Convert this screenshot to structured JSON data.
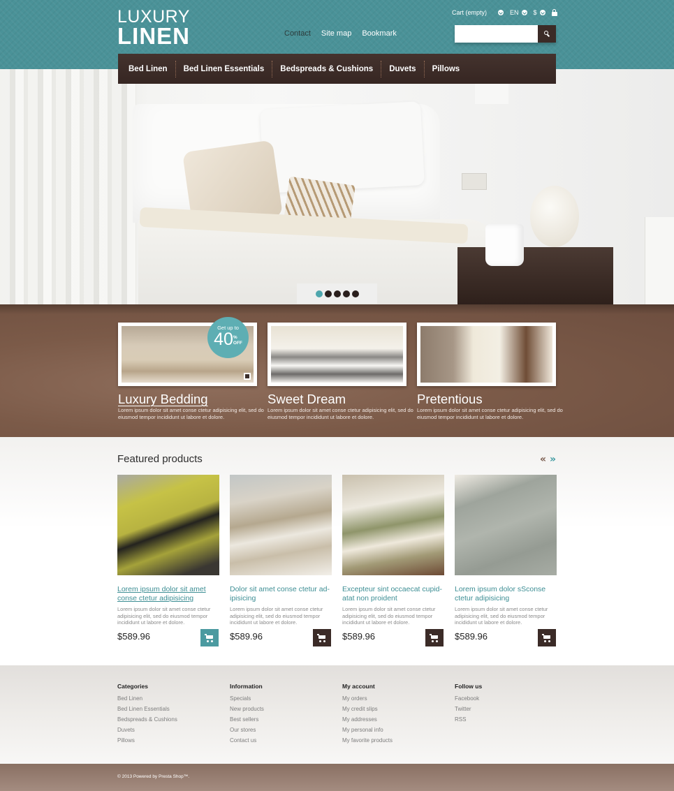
{
  "header": {
    "logo": {
      "line1": "LUXURY",
      "line2": "LINEN"
    },
    "top_links": [
      {
        "label": "Contact",
        "active": true
      },
      {
        "label": "Site map",
        "active": false
      },
      {
        "label": "Bookmark",
        "active": false
      }
    ],
    "user_bar": {
      "cart_label": "Cart (empty)",
      "language": "EN",
      "currency": "$",
      "lock_icon": "lock-icon"
    },
    "search": {
      "placeholder": "",
      "value": "",
      "button_icon": "search-icon"
    }
  },
  "nav": {
    "items": [
      "Bed Linen",
      "Bed Linen Essentials",
      "Bedspreads & Cushions",
      "Duvets",
      "Pillows"
    ]
  },
  "slider": {
    "slide_count": 5,
    "active_index": 0
  },
  "banners": [
    {
      "title": "Luxury Bedding",
      "text": "Lorem ipsum dolor sit amet conse ctetur adipisicing elit, sed do eiusmod tempor incididunt ut labore et dolore.",
      "badge": {
        "line1": "Get up to",
        "value": "40",
        "percent": "%",
        "off": "OFF"
      }
    },
    {
      "title": "Sweet Dream",
      "text": "Lorem ipsum dolor sit amet conse ctetur adipisicing elit, sed do eiusmod tempor incididunt ut labore et dolore."
    },
    {
      "title": "Pretentious",
      "text": "Lorem ipsum dolor sit amet conse ctetur adipisicing elit, sed do eiusmod tempor incididunt ut labore et dolore."
    }
  ],
  "featured": {
    "title": "Featured products",
    "prev_icon": "«",
    "next_icon": "»",
    "products": [
      {
        "name": "Lorem ipsum dolor sit amet conse ctetur adipisicing",
        "desc": "Lorem ipsum dolor sit amet conse ctetur adipisicing elit, sed do eiusmod tempor incididunt ut labore et dolore.",
        "price": "$589.96"
      },
      {
        "name": "Dolor sit amet conse ctetur ad-ipisicing",
        "desc": "Lorem ipsum dolor sit amet conse ctetur adipisicing elit, sed do eiusmod tempor incididunt ut labore et dolore.",
        "price": "$589.96"
      },
      {
        "name": "Excepteur sint occaecat cupid-atat non proident",
        "desc": "Lorem ipsum dolor sit amet conse ctetur adipisicing elit, sed do eiusmod tempor incididunt ut labore et dolore.",
        "price": "$589.96"
      },
      {
        "name": "Lorem ipsum dolor sSconse ctetur adipisicing",
        "desc": "Lorem ipsum dolor sit amet conse ctetur adipisicing elit, sed do eiusmod tempor incididunt ut labore et dolore.",
        "price": "$589.96"
      }
    ]
  },
  "footer": {
    "columns": [
      {
        "title": "Categories",
        "links": [
          "Bed Linen",
          "Bed Linen Essentials",
          "Bedspreads & Cushions",
          "Duvets",
          "Pillows"
        ]
      },
      {
        "title": "Information",
        "links": [
          "Specials",
          "New products",
          "Best sellers",
          "Our stores",
          "Contact us"
        ]
      },
      {
        "title": "My account",
        "links": [
          "My orders",
          "My credit slips",
          "My addresses",
          "My personal info",
          "My favorite products"
        ]
      },
      {
        "title": "Follow us",
        "links": [
          "Facebook",
          "Twitter",
          "RSS"
        ]
      }
    ],
    "copyright": "© 2013 Powered by Presta Shop™."
  },
  "colors": {
    "header_teal": "#4a9298",
    "nav_brown": "#3b2b27",
    "accent_teal": "#4ea6ad",
    "banner_brown": "#7b5a48",
    "link_teal": "#3d8e94"
  }
}
